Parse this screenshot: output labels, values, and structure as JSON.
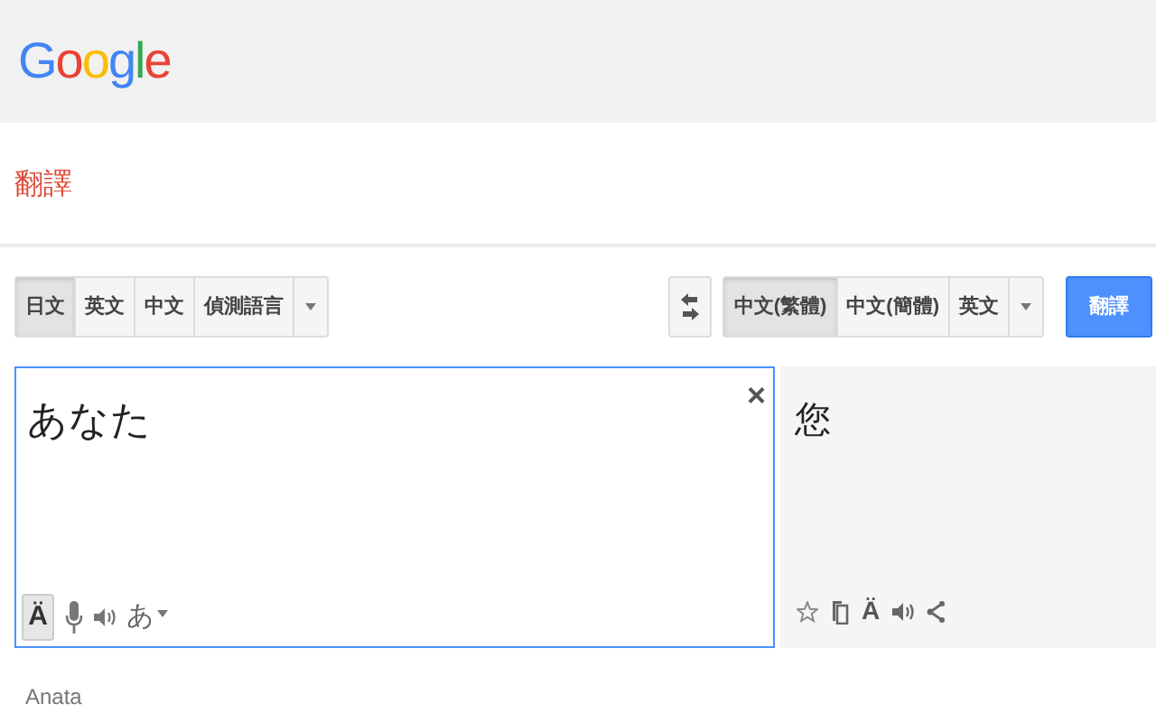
{
  "header": {
    "logo": "Google"
  },
  "title": "翻譯",
  "source_languages": [
    {
      "label": "日文",
      "selected": true
    },
    {
      "label": "英文",
      "selected": false
    },
    {
      "label": "中文",
      "selected": false
    },
    {
      "label": "偵測語言",
      "selected": false
    }
  ],
  "target_languages": [
    {
      "label": "中文(繁體)",
      "selected": true
    },
    {
      "label": "中文(簡體)",
      "selected": false
    },
    {
      "label": "英文",
      "selected": false
    }
  ],
  "translate_button": "翻譯",
  "source": {
    "value": "あなた",
    "clear": "×",
    "accent_key": {
      "label": "Ä",
      "selected": true
    },
    "input_tool": "あ"
  },
  "romanization": "Anata",
  "result": {
    "text": "您",
    "accent_key": "Ä"
  }
}
